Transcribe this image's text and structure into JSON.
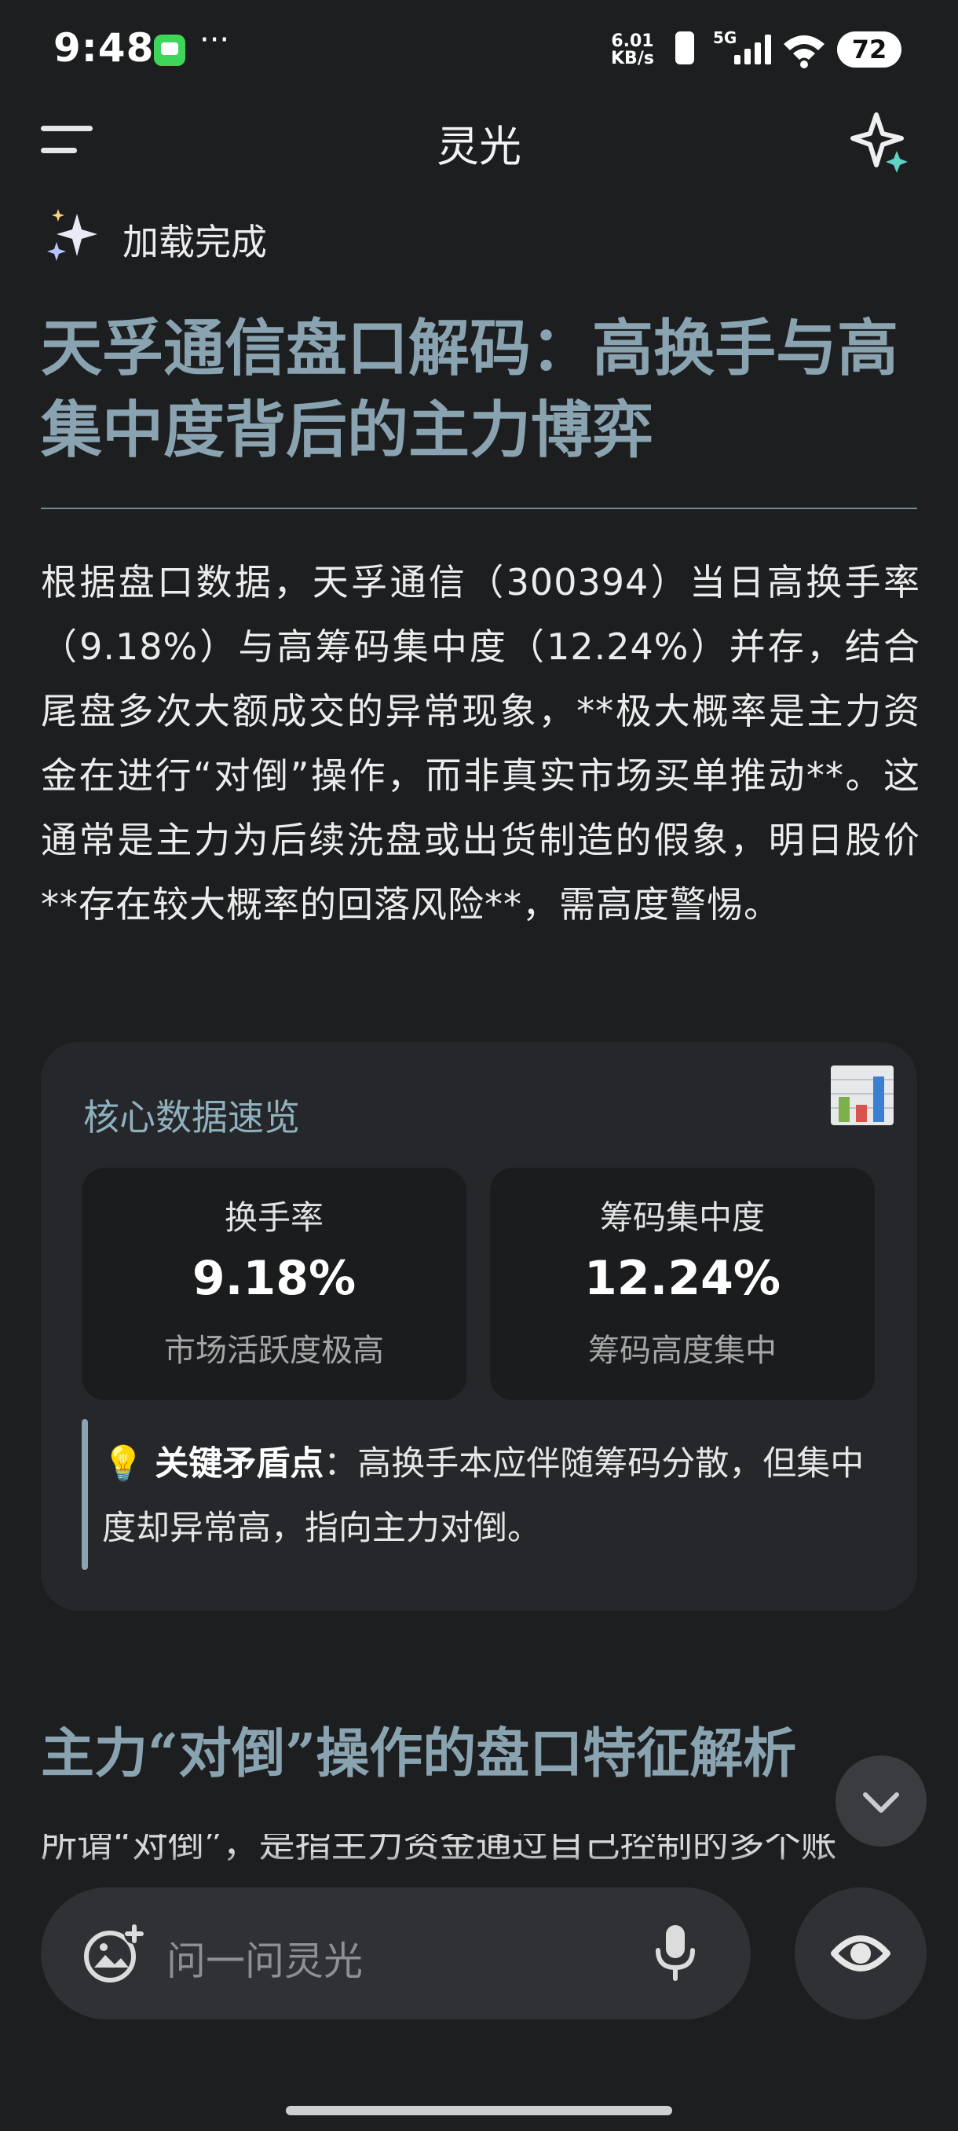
{
  "status_bar": {
    "time": "9:48",
    "net_speed_value": "6.01",
    "net_speed_unit": "KB/s",
    "network_type": "5G",
    "battery": "72"
  },
  "app_bar": {
    "title": "灵光"
  },
  "loaded_status": "加载完成",
  "article": {
    "headline": "天孚通信盘口解码：高换手与高集中度背后的主力博弈",
    "intro": "根据盘口数据，天孚通信（300394）当日高换手率（9.18%）与高筹码集中度（12.24%）并存，结合尾盘多次大额成交的异常现象，**极大概率是主力资金在进行“对倒”操作，而非真实市场买单推动**。这通常是主力为后续洗盘或出货制造的假象，明日股价**存在较大概率的回落风险**，需高度警惕。",
    "card": {
      "title": "核心数据速览",
      "stats": [
        {
          "label": "换手率",
          "value": "9.18%",
          "note": "市场活跃度极高"
        },
        {
          "label": "筹码集中度",
          "value": "12.24%",
          "note": "筹码高度集中"
        }
      ],
      "key_point_label": "关键矛盾点",
      "key_point_text": "：高换手本应伴随筹码分散，但集中度却异常高，指向主力对倒。"
    },
    "section_heading": "主力“对倒”操作的盘口特征解析",
    "section_intro": "所谓“对倒”，是指主力资金通过自己控制的多个账"
  },
  "input": {
    "placeholder": "问一问灵光"
  },
  "colors": {
    "accent": "#8aa3b0",
    "background": "#1d1e20",
    "card": "#25272a"
  }
}
